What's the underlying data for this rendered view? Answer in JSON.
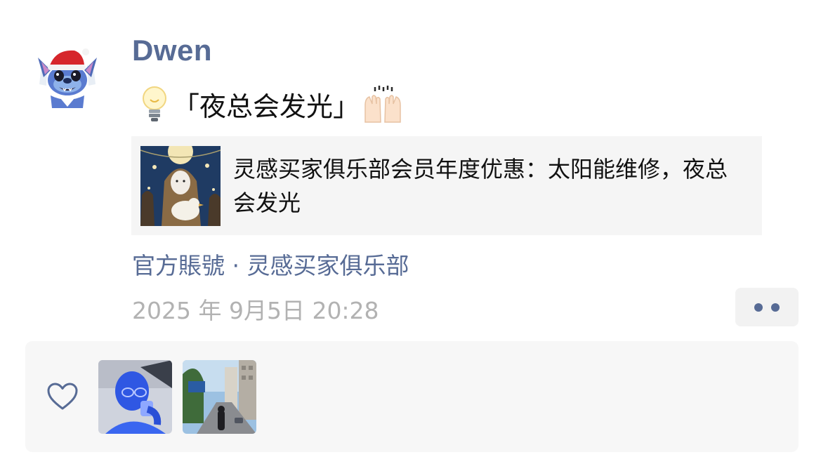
{
  "post": {
    "username": "Dwen",
    "content": {
      "left_icon": "light-bulb-emoji",
      "text": "「夜总会发光」",
      "right_icon": "raising-hands-emoji"
    },
    "link_card": {
      "thumbnail_icon": "hooded-figure-with-bird-illustration",
      "title": "灵感买家俱乐部会员年度优惠：太阳能维修，夜总会发光"
    },
    "source": "官方賬號 · 灵感买家俱乐部",
    "timestamp": "2025 年 9月5日 20:28",
    "more_icon": "ellipsis-two-dots-icon"
  },
  "likes": {
    "icon": "heart-outline-icon",
    "likers": [
      {
        "avatar_icon": "person-drinking-blue-tint-avatar"
      },
      {
        "avatar_icon": "city-street-photo-avatar"
      }
    ]
  },
  "colors": {
    "link_blue": "#576b95",
    "timestamp_gray": "#b2b2b2",
    "card_bg": "#f5f5f5",
    "likes_bg": "#f7f7f7"
  }
}
